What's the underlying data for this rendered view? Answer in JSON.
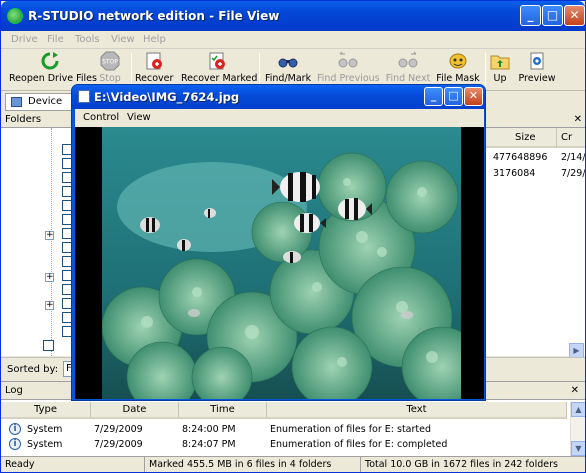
{
  "window": {
    "title": "R-STUDIO network edition - File View",
    "controls": {
      "minimize": "_",
      "maximize": "□",
      "close": "✕"
    }
  },
  "menu": [
    "Drive",
    "File",
    "Tools",
    "View",
    "Help"
  ],
  "toolbar": {
    "reopen": "Reopen Drive Files",
    "stop": "Stop",
    "recover": "Recover",
    "recover_marked": "Recover Marked",
    "find_mark": "Find/Mark",
    "find_previous": "Find Previous",
    "find_next": "Find Next",
    "file_mask": "File Mask",
    "up": "Up",
    "preview": "Preview"
  },
  "device_view": {
    "label": "Device vi"
  },
  "folders": {
    "title": "Folders",
    "close": "✕"
  },
  "file_list": {
    "columns": [
      "Size",
      "Cr"
    ],
    "rows": [
      {
        "size": "477648896",
        "created": "2/14/"
      },
      {
        "size": "3176084",
        "created": "7/29/"
      }
    ],
    "close": "✕"
  },
  "sorted_by": {
    "label": "Sorted by:",
    "value": "F"
  },
  "log": {
    "title": "Log",
    "close": "✕",
    "columns": [
      "Type",
      "Date",
      "Time",
      "Text"
    ],
    "rows": [
      {
        "type": "System",
        "date": "7/29/2009",
        "time": "8:24:00 PM",
        "text": "Enumeration of files for E: started"
      },
      {
        "type": "System",
        "date": "7/29/2009",
        "time": "8:24:07 PM",
        "text": "Enumeration of files for E: completed"
      }
    ]
  },
  "status": {
    "ready": "Ready",
    "marked": "Marked 455.5 MB in 6 files in 4 folders",
    "total": "Total 10.0 GB in 1672 files in 242 folders"
  },
  "viewer": {
    "title": "E:\\Video\\IMG_7624.jpg",
    "menu": [
      "Control",
      "View"
    ],
    "image_description": "underwater-photo-coral-reef-with-damselfish"
  }
}
